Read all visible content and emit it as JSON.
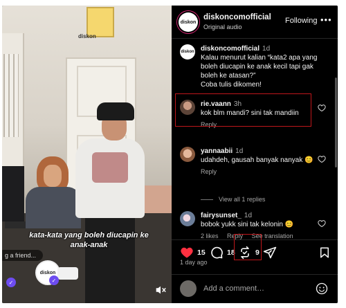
{
  "header": {
    "username": "diskoncomofficial",
    "subtitle": "Original audio",
    "follow_label": "Following",
    "more_label": "•••",
    "logo_text": "diskon"
  },
  "video": {
    "caption_line1": "kata-kata yang boleh diucapin ke",
    "caption_line2": "anak-anak",
    "tag_friend": "g a friend...",
    "watermark": "diskon",
    "avatar_text": "diskon"
  },
  "post": {
    "username": "diskoncomofficial",
    "time": "1d",
    "text": "Kalau menurut kalian “kata2 apa yang boleh diucapin ke anak kecil tapi gak boleh ke atasan?”",
    "cta": "Coba tulis dikomen!"
  },
  "comments": [
    {
      "username": "rie.vaann",
      "time": "3h",
      "text": "kok blm mandi? sini tak mandiin",
      "meta": [
        "Reply"
      ]
    },
    {
      "username": "yannaabii",
      "time": "1d",
      "text": "udahdeh, gausah banyak nanyak 😊",
      "meta": [
        "Reply"
      ]
    },
    {
      "username": "fairysunset_",
      "time": "1d",
      "text": "bobok yukk sini tak kelonin 😊",
      "meta": [
        "2 likes",
        "Reply",
        "See translation"
      ]
    }
  ],
  "view_replies": "View all 1 replies",
  "actions": {
    "likes": "15",
    "comments": "18",
    "reposts": "9"
  },
  "posted_ago": "1 day ago",
  "add_comment_placeholder": "Add a comment…",
  "colors": {
    "background": "#000000",
    "like_red": "#ff3040",
    "highlight_box": "#c0171b",
    "muted_text": "#a8a8a8"
  }
}
